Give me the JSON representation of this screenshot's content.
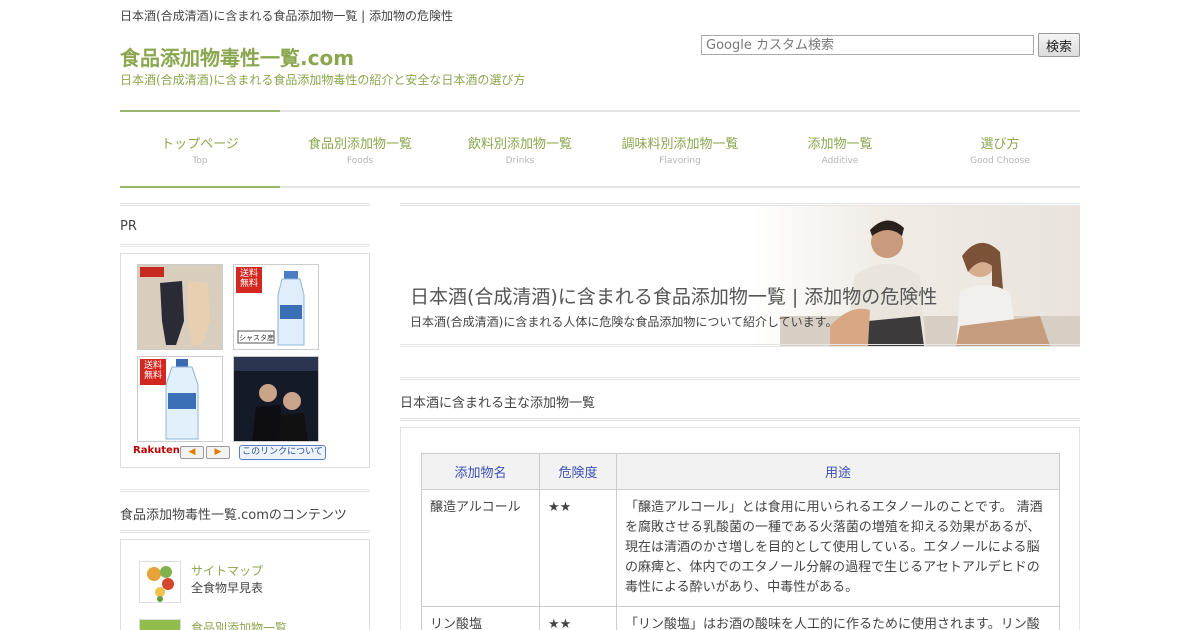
{
  "header": {
    "page_title": "日本酒(合成清酒)に含まれる食品添加物一覧 | 添加物の危険性",
    "site_title": "食品添加物毒性一覧.com",
    "site_description": "日本酒(合成清酒)に含まれる食品添加物毒性の紹介と安全な日本酒の選び方",
    "search_placeholder": "Google カスタム検索",
    "search_button": "検索"
  },
  "nav": [
    {
      "label": "トップページ",
      "sub": "Top"
    },
    {
      "label": "食品別添加物一覧",
      "sub": "Foods"
    },
    {
      "label": "飲料別添加物一覧",
      "sub": "Drinks"
    },
    {
      "label": "調味料別添加物一覧",
      "sub": "Flavoring"
    },
    {
      "label": "添加物一覧",
      "sub": "Additive"
    },
    {
      "label": "選び方",
      "sub": "Good Choose"
    }
  ],
  "sidebar": {
    "pr_title": "PR",
    "pr_badge": "送料無料",
    "pr_label_water": "シャスタ産",
    "pr_rakuten": "Rakuten",
    "pr_link_about": "このリンクについて",
    "contents_title": "食品添加物毒性一覧.comのコンテンツ",
    "contents": [
      {
        "title": "サイトマップ",
        "desc": "全食物早見表"
      },
      {
        "title": "食品別添加物一覧",
        "desc": ""
      }
    ]
  },
  "main": {
    "hero_title": "日本酒(合成清酒)に含まれる食品添加物一覧 | 添加物の危険性",
    "hero_subtitle": "日本酒(合成清酒)に含まれる人体に危険な食品添加物について紹介しています。",
    "section_title": "日本酒に含まれる主な添加物一覧",
    "table": {
      "headers": [
        "添加物名",
        "危険度",
        "用途"
      ],
      "rows": [
        {
          "name": "醸造アルコール",
          "risk": "★★",
          "use": "「醸造アルコール」とは食用に用いられるエタノールのことです。 清酒を腐敗させる乳酸菌の一種である火落菌の増殖を抑える効果があるが、現在は清酒のかさ増しを目的として使用している。エタノールによる脳の麻痺と、体内でのエタノール分解の過程で生じるアセトアルデヒドの毒性による酔いがあり、中毒性がある。"
        },
        {
          "name": "リン酸塩",
          "risk": "★★",
          "use": "「リン酸塩」はお酒の酸味を人工的に作るために使用されます。リン酸"
        }
      ]
    }
  }
}
